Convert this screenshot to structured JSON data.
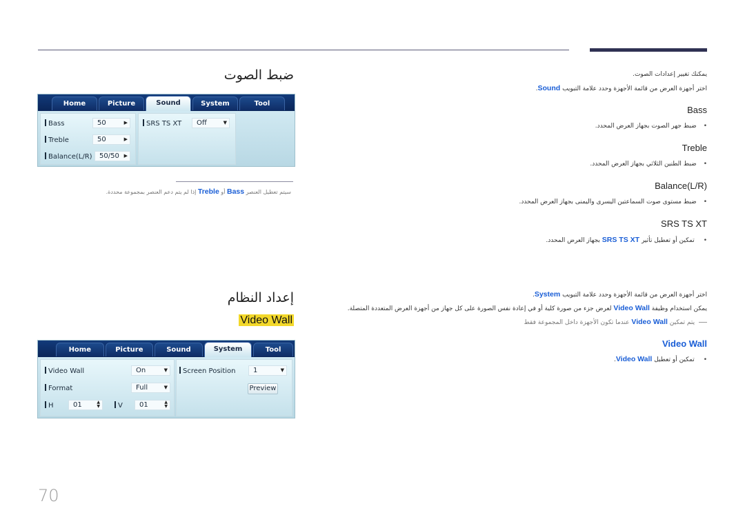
{
  "page_number": "70",
  "sections": {
    "sound": {
      "title": "ضبط الصوت",
      "panel": {
        "tabs": [
          "Home",
          "Picture",
          "Sound",
          "System",
          "Tool"
        ],
        "active_tab": "Sound",
        "fields": [
          {
            "label": "Bass",
            "value": "50"
          },
          {
            "label": "Treble",
            "value": "50"
          },
          {
            "label": "Balance(L/R)",
            "value": "50/50"
          }
        ],
        "srs": {
          "label": "SRS TS XT",
          "value": "Off"
        }
      },
      "note": {
        "pre": "سيتم تعطيل العنصر",
        "kw1": "Bass",
        "mid": "أو",
        "kw2": "Treble",
        "post": "إذا لم يتم دعم العنصر بمجموعة محددة."
      },
      "intro": "يمكنك تغيير إعدادات الصوت.",
      "instruction": {
        "pre": "اختر أجهزة العرض من قائمة الأجهزة وحدد علامة التبويب",
        "kw": "Sound",
        "post": "."
      },
      "items": [
        {
          "heading": "Bass",
          "desc": "ضبط جهر الصوت بجهاز العرض المحدد."
        },
        {
          "heading": "Treble",
          "desc": "ضبط الطنين الثلاثي بجهاز العرض المحدد."
        },
        {
          "heading": "Balance(L/R)",
          "desc": "ضبط مستوى صوت السماعتين اليسرى واليمنى بجهاز العرض المحدد."
        },
        {
          "heading": "SRS TS XT",
          "desc_pre": "تمكين أو تعطيل تأثير",
          "desc_kw": "SRS TS XT",
          "desc_post": "بجهاز العرض المحدد."
        }
      ]
    },
    "system": {
      "title": "إعداد النظام",
      "subtitle": "Video Wall",
      "panel": {
        "tabs": [
          "Home",
          "Picture",
          "Sound",
          "System",
          "Tool"
        ],
        "active_tab": "System",
        "video_wall": {
          "label": "Video Wall",
          "value": "On"
        },
        "format": {
          "label": "Format",
          "value": "Full"
        },
        "h": {
          "label": "H",
          "value": "01"
        },
        "v": {
          "label": "V",
          "value": "01"
        },
        "screen_position": {
          "label": "Screen Position",
          "value": "1"
        },
        "preview_label": "Preview"
      },
      "instruction": {
        "pre": "اختر أجهزة العرض من قائمة الأجهزة وحدد علامة التبويب",
        "kw": "System",
        "post": "."
      },
      "desc": {
        "pre": "يمكن استخدام وظيفة",
        "kw": "Video Wall",
        "post": "لعرض جزء من صورة كلية أو في إعادة نفس الصورة على كل جهاز من أجهزة العرض المتعددة المتصلة."
      },
      "note": {
        "pre": "يتم تمكين",
        "kw": "Video Wall",
        "post": "عندما تكون الأجهزة داخل المجموعة فقط"
      },
      "item": {
        "heading": "Video Wall",
        "desc_pre": "تمكين أو تعطيل",
        "desc_kw": "Video Wall",
        "desc_post": "."
      }
    }
  }
}
